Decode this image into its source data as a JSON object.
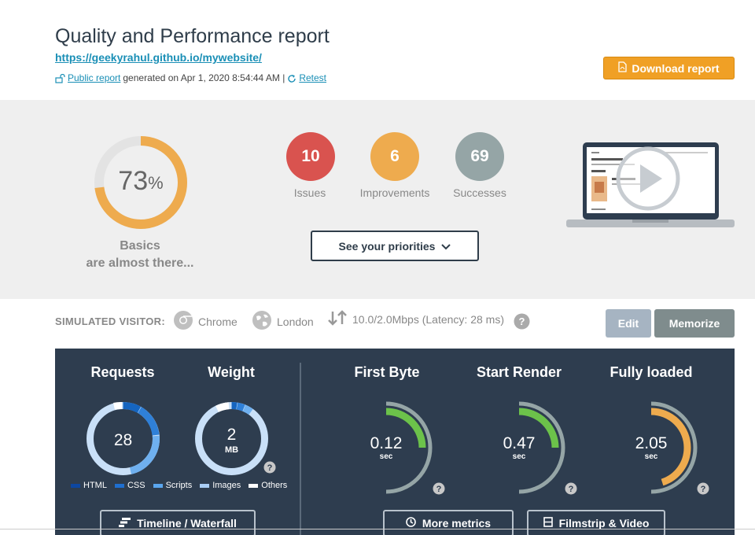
{
  "header": {
    "title": "Quality and Performance report",
    "url": "https://geekyrahul.github.io/mywebsite/",
    "public_report_label": "Public report",
    "generated_text": "generated on Apr 1, 2020 8:54:44 AM |",
    "retest_label": "Retest",
    "download_label": "Download report"
  },
  "summary": {
    "score": "73",
    "score_unit": "%",
    "score_fraction": 0.73,
    "basics_line1": "Basics",
    "basics_line2": "are almost there...",
    "issues": {
      "count": "10",
      "label": "Issues"
    },
    "improvements": {
      "count": "6",
      "label": "Improvements"
    },
    "successes": {
      "count": "69",
      "label": "Successes"
    },
    "priorities_label": "See your priorities"
  },
  "visitor": {
    "label": "SIMULATED VISITOR:",
    "browser": "Chrome",
    "location": "London",
    "connection": "10.0/2.0Mbps (Latency: 28 ms)",
    "help": "?",
    "edit_label": "Edit",
    "memorize_label": "Memorize"
  },
  "metrics": {
    "requests": {
      "title": "Requests",
      "value": "28"
    },
    "weight": {
      "title": "Weight",
      "value": "2",
      "unit": "MB"
    },
    "legend": [
      "HTML",
      "CSS",
      "Scripts",
      "Images",
      "Others"
    ],
    "first_byte": {
      "title": "First Byte",
      "value": "0.12",
      "unit": "sec"
    },
    "start_render": {
      "title": "Start Render",
      "value": "0.47",
      "unit": "sec"
    },
    "fully_loaded": {
      "title": "Fully loaded",
      "value": "2.05",
      "unit": "sec"
    },
    "timeline_label": "Timeline / Waterfall",
    "more_metrics_label": "More metrics",
    "filmstrip_label": "Filmstrip & Video"
  },
  "colors": {
    "orange": "#f0a025",
    "red": "#d9534f",
    "amber": "#eeab4e",
    "gray": "#95a5a6",
    "navy": "#2e3d4f",
    "green": "#6cc24a"
  }
}
